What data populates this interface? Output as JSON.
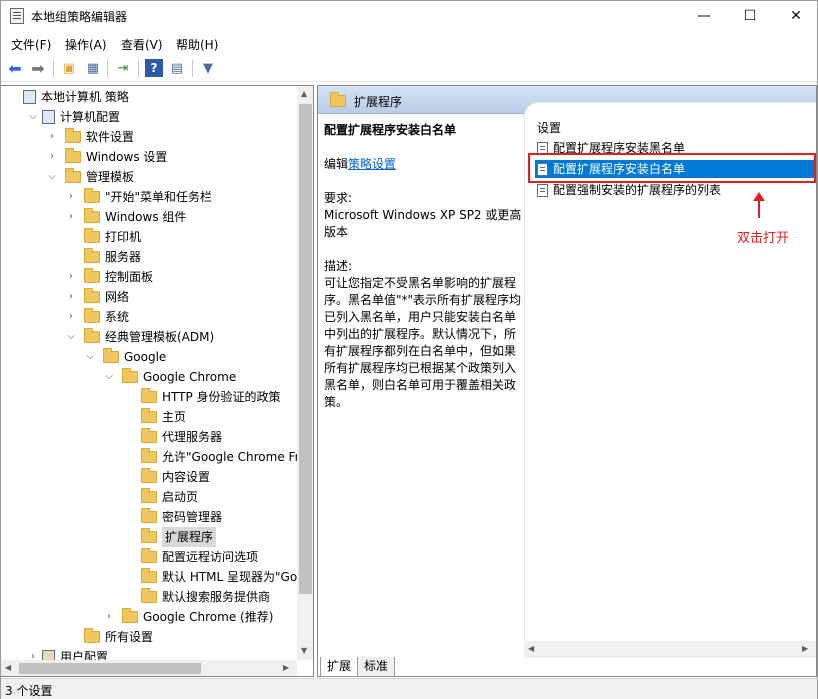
{
  "window": {
    "title": "本地组策略编辑器",
    "min_glyph": "—",
    "max_glyph": "☐",
    "close_glyph": "✕"
  },
  "menu": [
    "文件(F)",
    "操作(A)",
    "查看(V)",
    "帮助(H)"
  ],
  "tree": [
    {
      "label": "本地计算机 策略",
      "icon": "policy-icon",
      "arrow": ""
    },
    {
      "label": "计算机配置",
      "icon": "computer-icon",
      "arrow": "⌵"
    },
    {
      "label": "软件设置",
      "icon": "folder-icon",
      "arrow": "›"
    },
    {
      "label": "Windows 设置",
      "icon": "folder-icon",
      "arrow": "›"
    },
    {
      "label": "管理模板",
      "icon": "folder-icon",
      "arrow": "⌵"
    },
    {
      "label": "\"开始\"菜单和任务栏",
      "icon": "folder-icon",
      "arrow": "›"
    },
    {
      "label": "Windows 组件",
      "icon": "folder-icon",
      "arrow": "›"
    },
    {
      "label": "打印机",
      "icon": "folder-icon",
      "arrow": ""
    },
    {
      "label": "服务器",
      "icon": "folder-icon",
      "arrow": ""
    },
    {
      "label": "控制面板",
      "icon": "folder-icon",
      "arrow": "›"
    },
    {
      "label": "网络",
      "icon": "folder-icon",
      "arrow": "›"
    },
    {
      "label": "系统",
      "icon": "folder-icon",
      "arrow": "›"
    },
    {
      "label": "经典管理模板(ADM)",
      "icon": "folder-icon",
      "arrow": "⌵"
    },
    {
      "label": "Google",
      "icon": "folder-icon",
      "arrow": "⌵"
    },
    {
      "label": "Google Chrome",
      "icon": "folder-icon",
      "arrow": "⌵"
    },
    {
      "label": "HTTP 身份验证的政策",
      "icon": "folder-icon",
      "arrow": ""
    },
    {
      "label": "主页",
      "icon": "folder-icon",
      "arrow": ""
    },
    {
      "label": "代理服务器",
      "icon": "folder-icon",
      "arrow": ""
    },
    {
      "label": "允许\"Google Chrome Fram",
      "icon": "folder-icon",
      "arrow": ""
    },
    {
      "label": "内容设置",
      "icon": "folder-icon",
      "arrow": ""
    },
    {
      "label": "启动页",
      "icon": "folder-icon",
      "arrow": ""
    },
    {
      "label": "密码管理器",
      "icon": "folder-icon",
      "arrow": ""
    },
    {
      "label": "扩展程序",
      "icon": "folder-icon",
      "arrow": ""
    },
    {
      "label": "配置远程访问选项",
      "icon": "folder-icon",
      "arrow": ""
    },
    {
      "label": "默认 HTML 呈现器为\"Goog",
      "icon": "folder-icon",
      "arrow": ""
    },
    {
      "label": "默认搜索服务提供商",
      "icon": "folder-icon",
      "arrow": ""
    },
    {
      "label": "Google Chrome (推荐)",
      "icon": "folder-icon",
      "arrow": "›"
    },
    {
      "label": "所有设置",
      "icon": "folder-icon",
      "arrow": ""
    },
    {
      "label": "用户配置",
      "icon": "user-icon",
      "arrow": "›"
    }
  ],
  "right": {
    "header_title": "扩展程序",
    "desc_title": "配置扩展程序安装白名单",
    "edit_prefix": "编辑",
    "edit_link": "策略设置",
    "req_label": "要求:",
    "req_text": "Microsoft Windows XP SP2 或更高版本",
    "desc_label": "描述:",
    "desc_text": "可让您指定不受黑名单影响的扩展程序。黑名单值\"*\"表示所有扩展程序均已列入黑名单，用户只能安装白名单中列出的扩展程序。默认情况下，所有扩展程序都列在白名单中，但如果所有扩展程序均已根据某个政策列入黑名单，则白名单可用于覆盖相关政策。",
    "list_header": "设置",
    "items": [
      "配置扩展程序安装黑名单",
      "配置扩展程序安装白名单",
      "配置强制安装的扩展程序的列表"
    ]
  },
  "annotation": "双击打开",
  "tabs": [
    "扩展",
    "标准"
  ],
  "status": "3 个设置",
  "colors": {
    "selection": "#0078d7",
    "annotation_red": "#e02020"
  }
}
